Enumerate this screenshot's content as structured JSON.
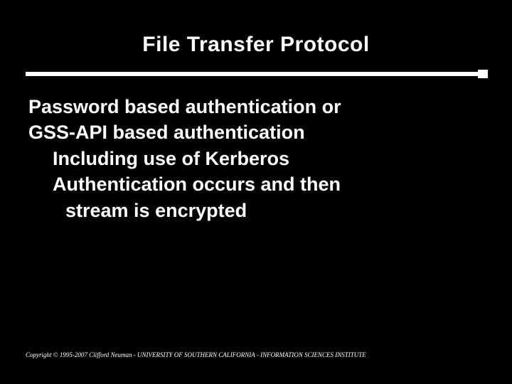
{
  "title": "File Transfer Protocol",
  "lines": {
    "l0": "Password based authentication or",
    "l1": "GSS-API based authentication",
    "l2": "Including use of Kerberos",
    "l3": "Authentication occurs and then",
    "l4": "stream is encrypted"
  },
  "footer": "Copyright © 1995-2007 Clifford Neuman - UNIVERSITY OF SOUTHERN CALIFORNIA - INFORMATION SCIENCES INSTITUTE"
}
